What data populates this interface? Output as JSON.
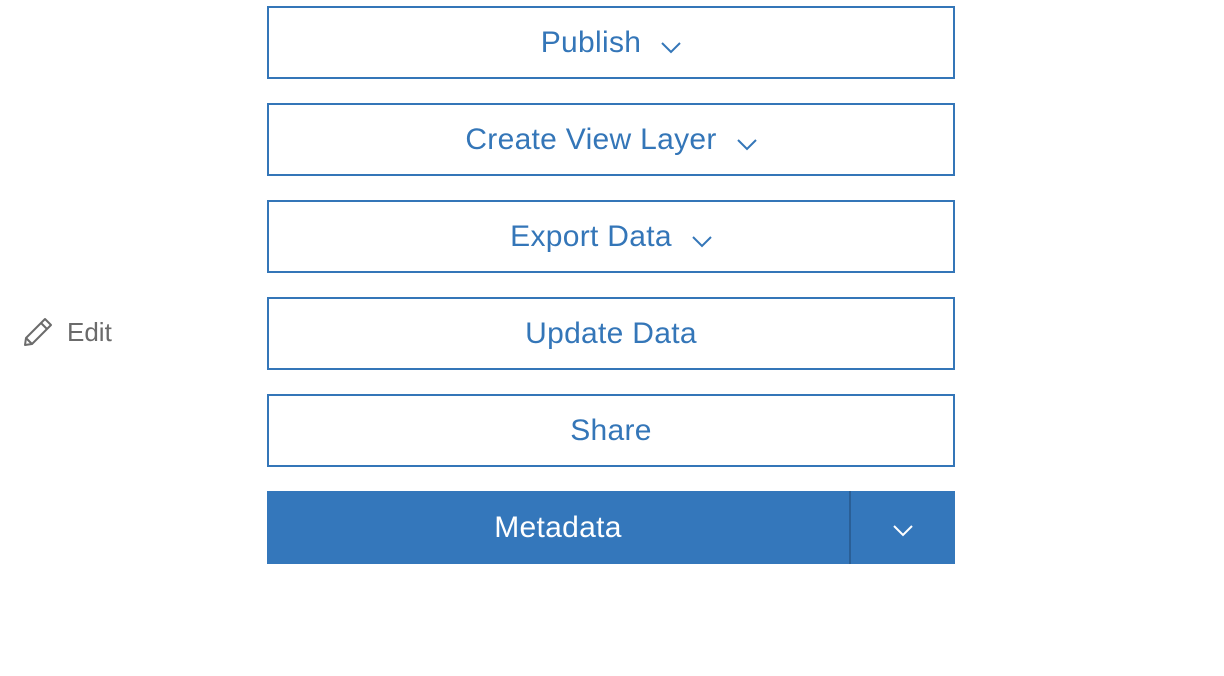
{
  "sidebar": {
    "edit_label": "Edit",
    "edit_icon": "pencil-icon"
  },
  "actions": {
    "publish_label": "Publish",
    "create_view_layer_label": "Create View Layer",
    "export_data_label": "Export Data",
    "update_data_label": "Update Data",
    "share_label": "Share",
    "metadata_label": "Metadata"
  },
  "colors": {
    "accent": "#3476b8",
    "edit_text": "#6b6b6b",
    "primary_fill": "#3477bb",
    "background": "#ffffff"
  }
}
